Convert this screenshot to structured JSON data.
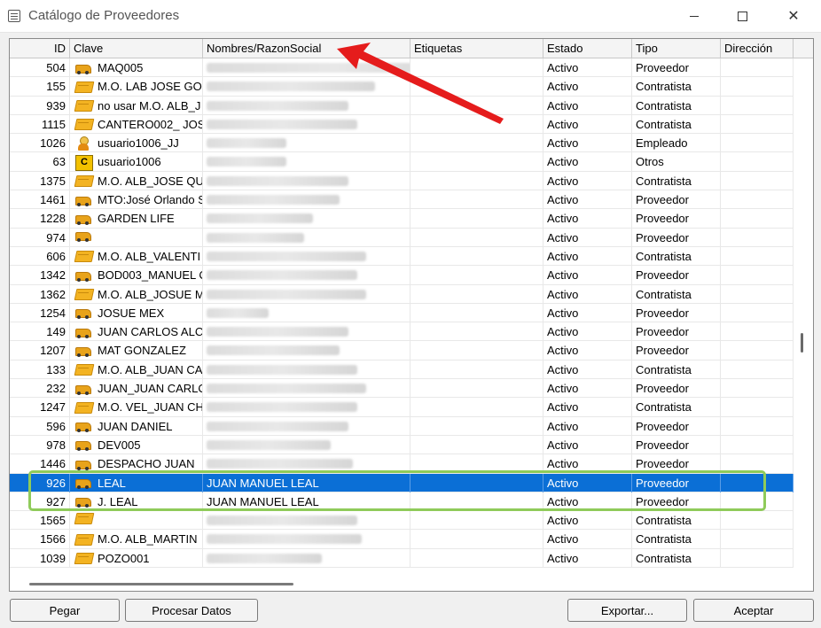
{
  "window": {
    "title": "Catálogo de Proveedores",
    "minimize_label": "",
    "close_label": "✕"
  },
  "columns": [
    "ID",
    "Clave",
    "Nombres/RazonSocial",
    "Etiquetas",
    "Estado",
    "Tipo",
    "Dirección"
  ],
  "rows": [
    {
      "id": "504",
      "clave": "MAQ005",
      "nombre": "",
      "etiquetas": "",
      "estado": "Activo",
      "tipo": "Proveedor",
      "icon": "truck-icon",
      "blur": 290
    },
    {
      "id": "155",
      "clave": "M.O. LAB JOSE GO",
      "nombre": "",
      "etiquetas": "",
      "estado": "Activo",
      "tipo": "Contratista",
      "icon": "box-icon",
      "blur": 190
    },
    {
      "id": "939",
      "clave": "no usar M.O. ALB_J",
      "nombre": "",
      "etiquetas": "",
      "estado": "Activo",
      "tipo": "Contratista",
      "icon": "box-icon",
      "blur": 160
    },
    {
      "id": "1115",
      "clave": "CANTERO002_ JOS",
      "nombre": "",
      "etiquetas": "",
      "estado": "Activo",
      "tipo": "Contratista",
      "icon": "box-icon",
      "blur": 170
    },
    {
      "id": "1026",
      "clave": "usuario1006_JJ",
      "nombre": "",
      "etiquetas": "",
      "estado": "Activo",
      "tipo": "Empleado",
      "icon": "person-icon",
      "blur": 90
    },
    {
      "id": "63",
      "clave": "usuario1006",
      "nombre": "",
      "etiquetas": "",
      "estado": "Activo",
      "tipo": "Otros",
      "icon": "other-icon",
      "blur": 90
    },
    {
      "id": "1375",
      "clave": "M.O. ALB_JOSE QU",
      "nombre": "",
      "etiquetas": "",
      "estado": "Activo",
      "tipo": "Contratista",
      "icon": "box-icon",
      "blur": 160
    },
    {
      "id": "1461",
      "clave": "MTO:José Orlando S",
      "nombre": "",
      "etiquetas": "",
      "estado": "Activo",
      "tipo": "Proveedor",
      "icon": "truck-icon",
      "blur": 150
    },
    {
      "id": "1228",
      "clave": "GARDEN LIFE",
      "nombre": "",
      "etiquetas": "",
      "estado": "Activo",
      "tipo": "Proveedor",
      "icon": "truck-icon",
      "blur": 120
    },
    {
      "id": "974",
      "clave": "",
      "nombre": "",
      "etiquetas": "",
      "estado": "Activo",
      "tipo": "Proveedor",
      "icon": "truck-icon",
      "blur": 110
    },
    {
      "id": "606",
      "clave": "M.O. ALB_VALENTI",
      "nombre": "",
      "etiquetas": "",
      "estado": "Activo",
      "tipo": "Contratista",
      "icon": "box-icon",
      "blur": 180
    },
    {
      "id": "1342",
      "clave": "BOD003_MANUEL C",
      "nombre": "",
      "etiquetas": "",
      "estado": "Activo",
      "tipo": "Proveedor",
      "icon": "truck-icon",
      "blur": 170
    },
    {
      "id": "1362",
      "clave": "M.O. ALB_JOSUE M",
      "nombre": "",
      "etiquetas": "",
      "estado": "Activo",
      "tipo": "Contratista",
      "icon": "box-icon",
      "blur": 180
    },
    {
      "id": "1254",
      "clave": "JOSUE MEX",
      "nombre": "",
      "etiquetas": "",
      "estado": "Activo",
      "tipo": "Proveedor",
      "icon": "truck-icon",
      "blur": 70
    },
    {
      "id": "149",
      "clave": "JUAN CARLOS ALC",
      "nombre": "",
      "etiquetas": "",
      "estado": "Activo",
      "tipo": "Proveedor",
      "icon": "truck-icon",
      "blur": 160
    },
    {
      "id": "1207",
      "clave": "MAT GONZALEZ",
      "nombre": "",
      "etiquetas": "",
      "estado": "Activo",
      "tipo": "Proveedor",
      "icon": "truck-icon",
      "blur": 150
    },
    {
      "id": "133",
      "clave": "M.O. ALB_JUAN CA",
      "nombre": "",
      "etiquetas": "",
      "estado": "Activo",
      "tipo": "Contratista",
      "icon": "box-icon",
      "blur": 170
    },
    {
      "id": "232",
      "clave": "JUAN_JUAN CARLO",
      "nombre": "",
      "etiquetas": "",
      "estado": "Activo",
      "tipo": "Proveedor",
      "icon": "truck-icon",
      "blur": 180
    },
    {
      "id": "1247",
      "clave": "M.O. VEL_JUAN CH",
      "nombre": "",
      "etiquetas": "",
      "estado": "Activo",
      "tipo": "Contratista",
      "icon": "box-icon",
      "blur": 170
    },
    {
      "id": "596",
      "clave": "JUAN DANIEL",
      "nombre": "",
      "etiquetas": "",
      "estado": "Activo",
      "tipo": "Proveedor",
      "icon": "truck-icon",
      "blur": 160
    },
    {
      "id": "978",
      "clave": "DEV005",
      "nombre": "",
      "etiquetas": "",
      "estado": "Activo",
      "tipo": "Proveedor",
      "icon": "truck-icon",
      "blur": 140
    },
    {
      "id": "1446",
      "clave": "DESPACHO JUAN",
      "nombre": "",
      "etiquetas": "",
      "estado": "Activo",
      "tipo": "Proveedor",
      "icon": "truck-icon",
      "blur": 165
    },
    {
      "id": "926",
      "clave": "LEAL",
      "nombre": "JUAN MANUEL LEAL",
      "etiquetas": "",
      "estado": "Activo",
      "tipo": "Proveedor",
      "icon": "truck-icon",
      "blur": 0,
      "selected": true
    },
    {
      "id": "927",
      "clave": "J. LEAL",
      "nombre": "JUAN MANUEL LEAL",
      "etiquetas": "",
      "estado": "Activo",
      "tipo": "Proveedor",
      "icon": "truck-icon",
      "blur": 0
    },
    {
      "id": "1565",
      "clave": "",
      "nombre": "",
      "etiquetas": "",
      "estado": "Activo",
      "tipo": "Contratista",
      "icon": "box-icon",
      "blur": 170
    },
    {
      "id": "1566",
      "clave": "M.O. ALB_MARTIN",
      "nombre": "",
      "etiquetas": "",
      "estado": "Activo",
      "tipo": "Contratista",
      "icon": "box-icon",
      "blur": 175
    },
    {
      "id": "1039",
      "clave": "POZO001",
      "nombre": "",
      "etiquetas": "",
      "estado": "Activo",
      "tipo": "Contratista",
      "icon": "box-icon",
      "blur": 130
    }
  ],
  "buttons": {
    "pegar": "Pegar",
    "procesar": "Procesar Datos",
    "exportar": "Exportar...",
    "aceptar": "Aceptar"
  },
  "colors": {
    "selection": "#0b6fd6",
    "highlight": "#8fcb5a",
    "arrow": "#e51c1c"
  }
}
